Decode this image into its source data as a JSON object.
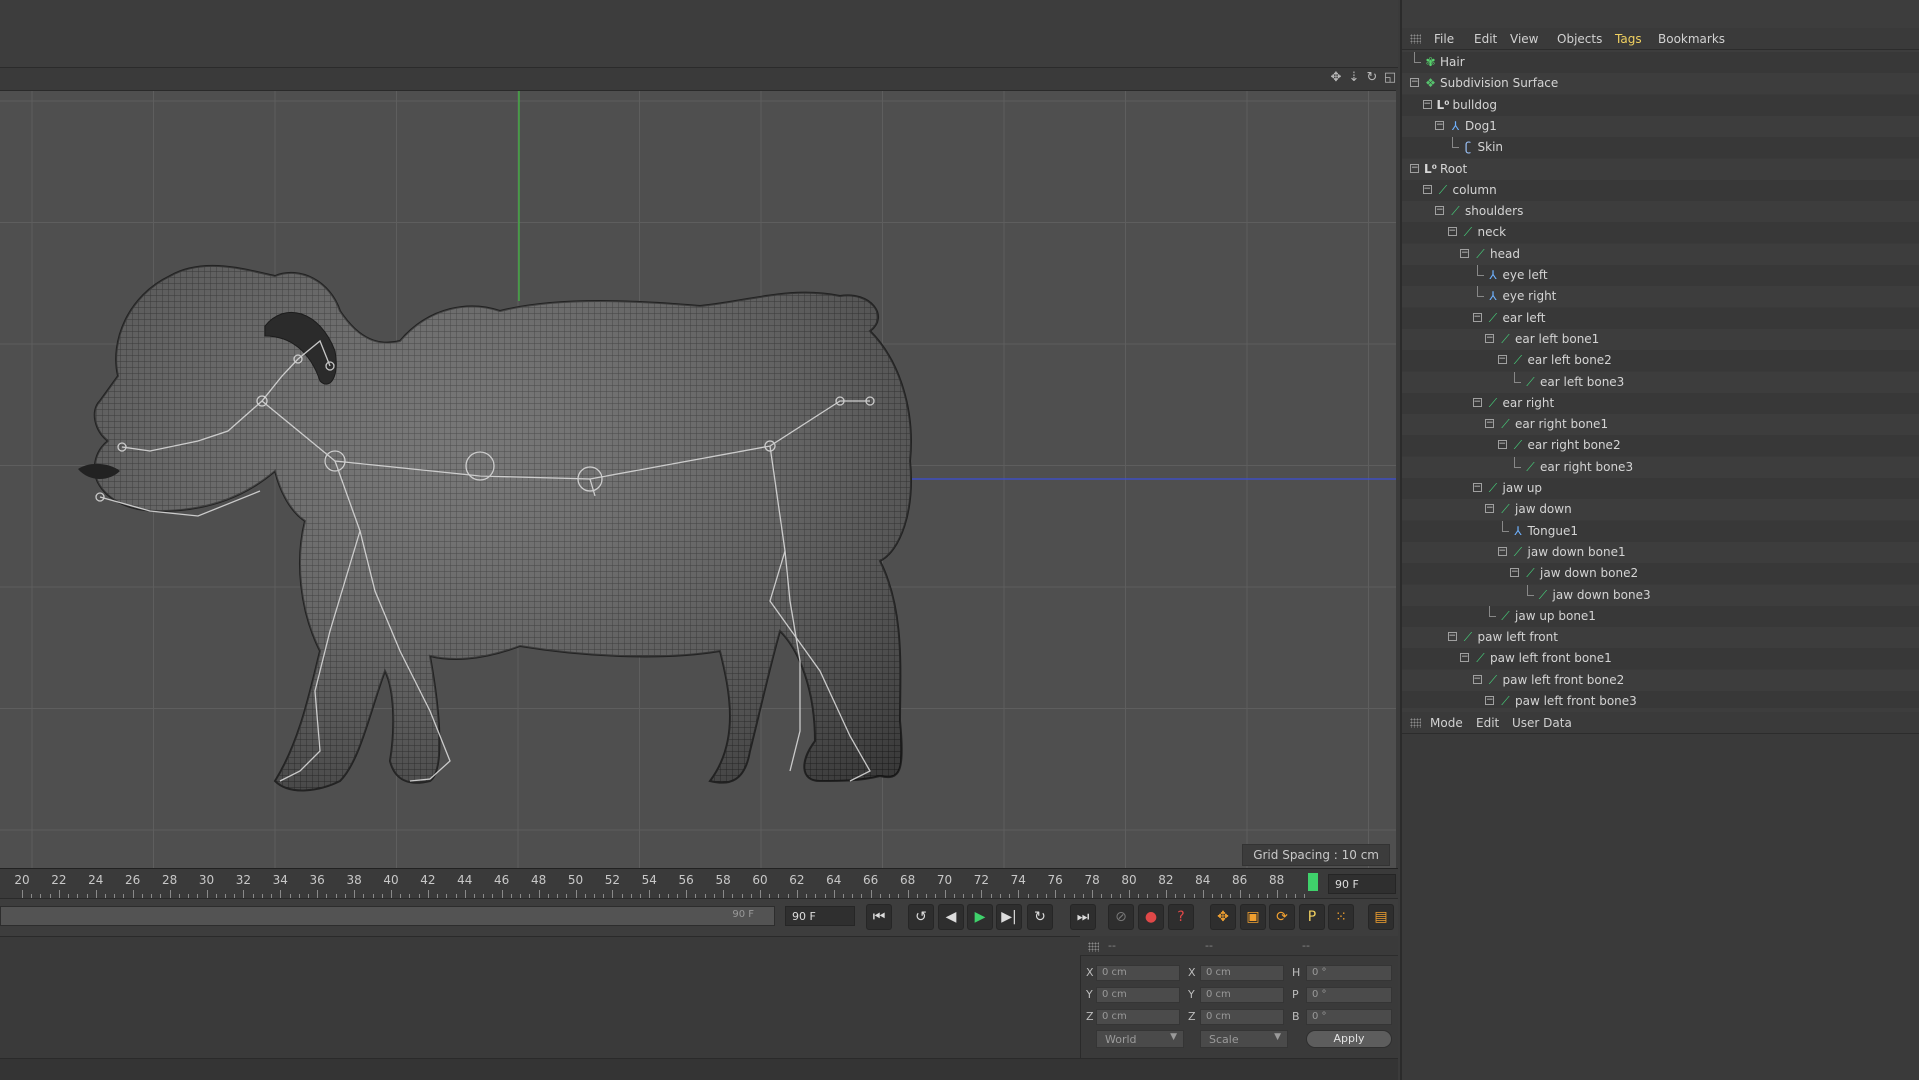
{
  "viewport": {
    "grid_spacing": "Grid Spacing : 10 cm",
    "header_icons": [
      "move-view-icon",
      "zoom-view-icon",
      "rotate-view-icon",
      "maximize-view-icon"
    ]
  },
  "timeline": {
    "ticks": [
      "20",
      "22",
      "24",
      "26",
      "28",
      "30",
      "32",
      "34",
      "36",
      "38",
      "40",
      "42",
      "44",
      "46",
      "48",
      "50",
      "52",
      "54",
      "56",
      "58",
      "60",
      "62",
      "64",
      "66",
      "68",
      "70",
      "72",
      "74",
      "76",
      "78",
      "80",
      "82",
      "84",
      "86",
      "88"
    ],
    "current_frame_field": "90 F"
  },
  "transport": {
    "range_end_label": "90 F",
    "frame_field": "90 F"
  },
  "coordinates": {
    "headers": [
      "--",
      "--",
      "--"
    ],
    "rows": [
      {
        "a_label": "X",
        "a_value": "0 cm",
        "b_label": "X",
        "b_value": "0 cm",
        "c_label": "H",
        "c_value": "0 °"
      },
      {
        "a_label": "Y",
        "a_value": "0 cm",
        "b_label": "Y",
        "b_value": "0 cm",
        "c_label": "P",
        "c_value": "0 °"
      },
      {
        "a_label": "Z",
        "a_value": "0 cm",
        "b_label": "Z",
        "b_value": "0 cm",
        "c_label": "B",
        "c_value": "0 °"
      }
    ],
    "space_dropdown": "World",
    "mode_dropdown": "Scale",
    "apply_label": "Apply"
  },
  "object_manager": {
    "menu": [
      "File",
      "Edit",
      "View",
      "Objects",
      "Tags",
      "Bookmarks"
    ],
    "active_menu": "Tags",
    "items": [
      {
        "label": "Hair",
        "depth": 0,
        "icon": "hair-icon",
        "expander": false
      },
      {
        "label": "Subdivision Surface",
        "depth": 0,
        "icon": "subdivision-icon",
        "expander": true
      },
      {
        "label": "bulldog",
        "depth": 1,
        "icon": "null-icon",
        "expander": true
      },
      {
        "label": "Dog1",
        "depth": 2,
        "icon": "joint-icon",
        "expander": true
      },
      {
        "label": "Skin",
        "depth": 3,
        "icon": "skin-icon",
        "expander": false
      },
      {
        "label": "Root",
        "depth": 0,
        "icon": "null-icon",
        "expander": true
      },
      {
        "label": "column",
        "depth": 1,
        "icon": "bone-icon",
        "expander": true
      },
      {
        "label": "shoulders",
        "depth": 2,
        "icon": "bone-icon",
        "expander": true
      },
      {
        "label": "neck",
        "depth": 3,
        "icon": "bone-icon",
        "expander": true
      },
      {
        "label": "head",
        "depth": 4,
        "icon": "bone-icon",
        "expander": true
      },
      {
        "label": "eye left",
        "depth": 5,
        "icon": "joint-icon",
        "expander": false
      },
      {
        "label": "eye right",
        "depth": 5,
        "icon": "joint-icon",
        "expander": false
      },
      {
        "label": "ear left",
        "depth": 5,
        "icon": "bone-icon",
        "expander": true
      },
      {
        "label": "ear left bone1",
        "depth": 6,
        "icon": "bone-icon",
        "expander": true
      },
      {
        "label": "ear left bone2",
        "depth": 7,
        "icon": "bone-icon",
        "expander": true
      },
      {
        "label": "ear left bone3",
        "depth": 8,
        "icon": "bone-icon",
        "expander": false
      },
      {
        "label": "ear right",
        "depth": 5,
        "icon": "bone-icon",
        "expander": true
      },
      {
        "label": "ear right bone1",
        "depth": 6,
        "icon": "bone-icon",
        "expander": true
      },
      {
        "label": "ear right bone2",
        "depth": 7,
        "icon": "bone-icon",
        "expander": true
      },
      {
        "label": "ear right bone3",
        "depth": 8,
        "icon": "bone-icon",
        "expander": false
      },
      {
        "label": "jaw up",
        "depth": 5,
        "icon": "bone-icon",
        "expander": true
      },
      {
        "label": "jaw down",
        "depth": 6,
        "icon": "bone-icon",
        "expander": true
      },
      {
        "label": "Tongue1",
        "depth": 7,
        "icon": "joint-icon",
        "expander": false
      },
      {
        "label": "jaw down bone1",
        "depth": 7,
        "icon": "bone-icon",
        "expander": true
      },
      {
        "label": "jaw down bone2",
        "depth": 8,
        "icon": "bone-icon",
        "expander": true
      },
      {
        "label": "jaw down bone3",
        "depth": 9,
        "icon": "bone-icon",
        "expander": false
      },
      {
        "label": "jaw up bone1",
        "depth": 6,
        "icon": "bone-icon",
        "expander": false
      },
      {
        "label": "paw left front",
        "depth": 3,
        "icon": "bone-icon",
        "expander": true
      },
      {
        "label": "paw left front  bone1",
        "depth": 4,
        "icon": "bone-icon",
        "expander": true
      },
      {
        "label": "paw left front  bone2",
        "depth": 5,
        "icon": "bone-icon",
        "expander": true
      },
      {
        "label": "paw left front  bone3",
        "depth": 6,
        "icon": "bone-icon",
        "expander": true
      }
    ]
  },
  "attribute_manager": {
    "menu": [
      "Mode",
      "Edit",
      "User Data"
    ]
  },
  "colors": {
    "viewport_bg": "#4f4f4f",
    "panel_bg": "#3a3a3a",
    "bone_green": "#46d07a",
    "active_menu": "#f0d060",
    "frame_marker": "#3fd16b"
  }
}
